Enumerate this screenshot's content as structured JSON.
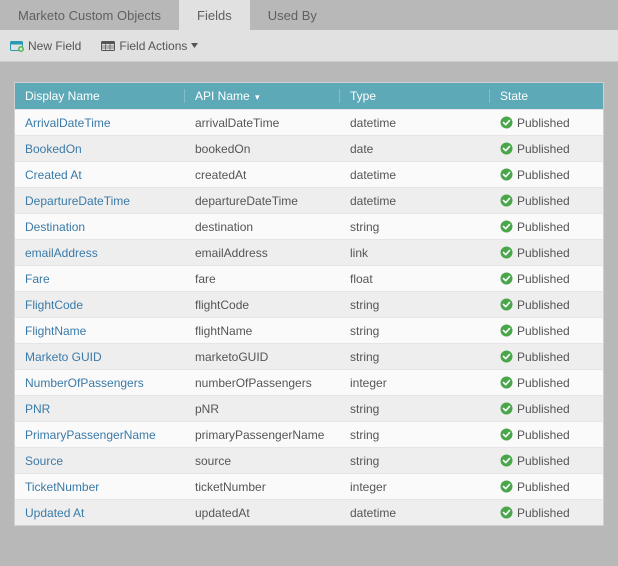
{
  "tabs": [
    {
      "label": "Marketo Custom Objects",
      "active": false
    },
    {
      "label": "Fields",
      "active": true
    },
    {
      "label": "Used By",
      "active": false
    }
  ],
  "toolbar": {
    "newField": "New Field",
    "fieldActions": "Field Actions"
  },
  "table": {
    "headers": {
      "displayName": "Display Name",
      "apiName": "API Name",
      "apiNameSort": "▾",
      "type": "Type",
      "state": "State"
    },
    "rows": [
      {
        "display": "ArrivalDateTime",
        "api": "arrivalDateTime",
        "type": "datetime",
        "state": "Published"
      },
      {
        "display": "BookedOn",
        "api": "bookedOn",
        "type": "date",
        "state": "Published"
      },
      {
        "display": "Created At",
        "api": "createdAt",
        "type": "datetime",
        "state": "Published"
      },
      {
        "display": "DepartureDateTime",
        "api": "departureDateTime",
        "type": "datetime",
        "state": "Published"
      },
      {
        "display": "Destination",
        "api": "destination",
        "type": "string",
        "state": "Published"
      },
      {
        "display": "emailAddress",
        "api": "emailAddress",
        "type": "link",
        "state": "Published"
      },
      {
        "display": "Fare",
        "api": "fare",
        "type": "float",
        "state": "Published"
      },
      {
        "display": "FlightCode",
        "api": "flightCode",
        "type": "string",
        "state": "Published"
      },
      {
        "display": "FlightName",
        "api": "flightName",
        "type": "string",
        "state": "Published"
      },
      {
        "display": "Marketo GUID",
        "api": "marketoGUID",
        "type": "string",
        "state": "Published"
      },
      {
        "display": "NumberOfPassengers",
        "api": "numberOfPassengers",
        "type": "integer",
        "state": "Published"
      },
      {
        "display": "PNR",
        "api": "pNR",
        "type": "string",
        "state": "Published"
      },
      {
        "display": "PrimaryPassengerName",
        "api": "primaryPassengerName",
        "type": "string",
        "state": "Published"
      },
      {
        "display": "Source",
        "api": "source",
        "type": "string",
        "state": "Published"
      },
      {
        "display": "TicketNumber",
        "api": "ticketNumber",
        "type": "integer",
        "state": "Published"
      },
      {
        "display": "Updated At",
        "api": "updatedAt",
        "type": "datetime",
        "state": "Published"
      }
    ]
  }
}
